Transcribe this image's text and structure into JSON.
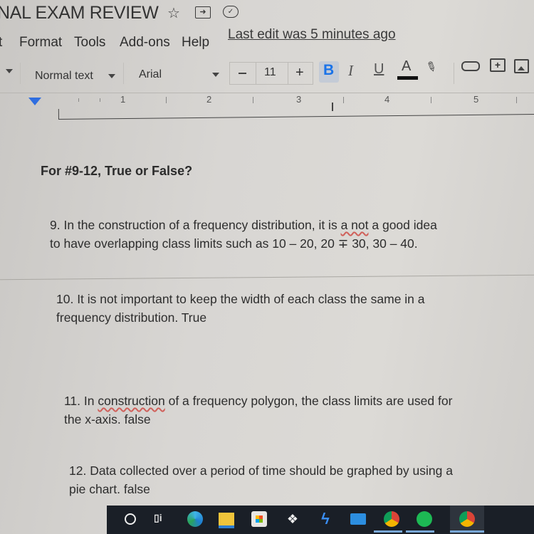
{
  "window": {
    "doc_title": "NAL EXAM REVIEW",
    "title_icons": [
      "star-icon",
      "move-to-folder-icon",
      "cloud-saved-icon"
    ]
  },
  "menu": {
    "items": [
      "t",
      "Format",
      "Tools",
      "Add-ons",
      "Help"
    ],
    "last_edit": "Last edit was 5 minutes ago"
  },
  "toolbar": {
    "style": "Normal text",
    "font": "Arial",
    "font_size": "11",
    "decrease": "−",
    "increase": "+",
    "bold": "B",
    "italic": "I",
    "underline": "U",
    "text_color": "A",
    "accent_color": "#1a73e8"
  },
  "ruler": {
    "numbers": [
      "1",
      "2",
      "3",
      "4",
      "5"
    ]
  },
  "content": {
    "heading": "For #9-12, True or False?",
    "questions": [
      {
        "line1_pre": "9.  In the construction of a frequency distribution, it is ",
        "line1_spell": "a not",
        "line1_post": " a good idea",
        "line2": "to have overlapping class limits such as 10 – 20, 20 ∓ 30, 30 – 40."
      },
      {
        "line1": "10.  It is not important to keep the width of each class the same in a",
        "line2": "frequency distribution. True"
      },
      {
        "line1_pre": "11.  In ",
        "line1_spell": "construction",
        "line1_post": " of a frequency polygon, the class limits are used for",
        "line2": "the x-axis. false"
      },
      {
        "line1": "12.  Data collected over a period of time should be graphed by using a",
        "line2": "pie chart. false"
      }
    ]
  },
  "taskbar": {
    "apps": [
      "search-icon",
      "task-view-icon",
      "edge-icon",
      "file-explorer-icon",
      "store-icon",
      "dropbox-icon",
      "app-icon",
      "mail-icon",
      "chrome-icon",
      "spotify-icon",
      "chrome-profile-icon"
    ]
  }
}
